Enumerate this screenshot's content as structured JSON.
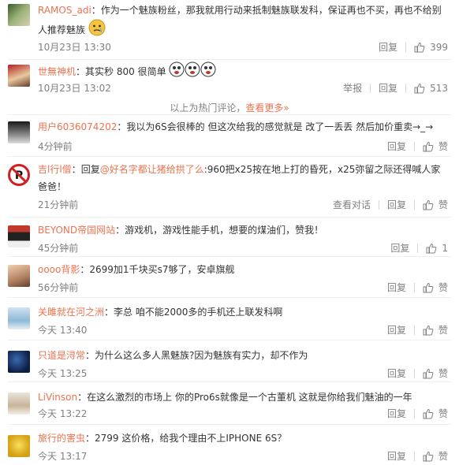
{
  "hot_notice": {
    "text": "以上为热门评论，",
    "more": "查看更多»"
  },
  "comments": [
    {
      "user": "RAMOS_adi",
      "sep": "：",
      "text": "作为一个魅族粉丝，那我就用行动来抵制魅族联发科，保证再也不买，再也不给别人推荐魅族",
      "time": "10月23日 13:30",
      "reply": "回复",
      "likes": "399"
    },
    {
      "user": "世無神机",
      "sep": "：",
      "text": "其实秒 800 很简单",
      "time": "10月23日 13:02",
      "report": "举报",
      "reply": "回复",
      "likes": "513"
    },
    {
      "user": "用户6036074202",
      "sep": "：",
      "text": "我以为6S会很棒的 但这次给我的感觉就是 改了一丢丢 然后加价重卖→_→",
      "time": "4分钟前",
      "reply": "回复",
      "likes": "赞"
    },
    {
      "user": "吉l行l僧",
      "sep": "：",
      "text_pre": "回复",
      "mention": "@好名字都让猪给拱了么",
      "text": ":960把x25按在地上打的昏死，x25弥留之际还得喊人家爸爸！",
      "time": "21分钟前",
      "view_conv": "查看对话",
      "reply": "回复",
      "likes": "赞"
    },
    {
      "user": "BEYOND帝国网站",
      "sep": "：",
      "text": "游戏机，游戏性能手机，想要的煤油们，赞我！",
      "time": "45分钟前",
      "reply": "回复",
      "likes": "1"
    },
    {
      "user": "oooo背影",
      "sep": "：",
      "text": "2699加1千块买s7够了，安卓旗舰",
      "time": "56分钟前",
      "reply": "回复",
      "likes": "赞"
    },
    {
      "user": "关雎就在河之洲",
      "sep": "：",
      "text": "李总 咱不能2000多的手机还上联发科啊",
      "time": "今天 13:40",
      "reply": "回复",
      "likes": "赞"
    },
    {
      "user": "只道是浔常",
      "sep": "：",
      "text": "为什么这么多人黑魅族?因为魅族有实力，却不作为",
      "time": "今天 13:25",
      "reply": "回复",
      "likes": "赞"
    },
    {
      "user": "LiVinson",
      "sep": "：",
      "text": "在这么激烈的市场上 你的Pro6s就像是一个古董机  这就是你给我们魅油的一年",
      "time": "今天 13:22",
      "reply": "回复",
      "likes": "赞"
    },
    {
      "user": "旅行的害虫",
      "sep": "：",
      "text": "2799 这价格，给我个理由不上IPHONE 6S？",
      "time": "今天 13:17",
      "reply": "回复",
      "likes": "赞"
    }
  ],
  "colors": {
    "username": "#eb7350",
    "meta": "#808080",
    "text": "#333333"
  }
}
